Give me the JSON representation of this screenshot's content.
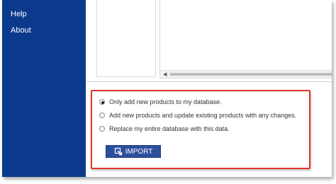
{
  "sidebar": {
    "items": [
      {
        "label": "Help"
      },
      {
        "label": "About"
      }
    ]
  },
  "import_options": {
    "selected_index": 0,
    "options": [
      {
        "label": "Only add new products to my database."
      },
      {
        "label": "Add new products and update existing products with any changes."
      },
      {
        "label": "Replace my entire database with this data."
      }
    ]
  },
  "import_button": {
    "label": "IMPORT",
    "icon": "import-icon"
  },
  "colors": {
    "sidebar": "#0b3a8c",
    "button": "#2c4f9c",
    "highlight_border": "#e0332b"
  }
}
